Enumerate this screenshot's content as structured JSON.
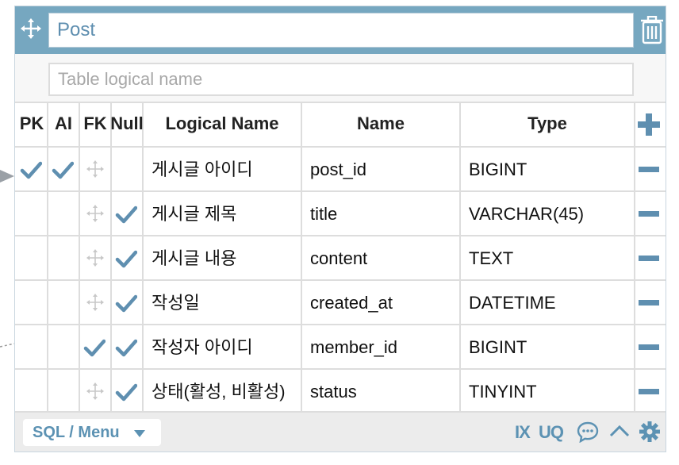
{
  "table": {
    "name": "Post",
    "logical_name": "",
    "logical_name_placeholder": "Table logical name"
  },
  "columns_header": {
    "pk": "PK",
    "ai": "AI",
    "fk": "FK",
    "null": "Null",
    "logical_name": "Logical Name",
    "name": "Name",
    "type": "Type"
  },
  "rows": [
    {
      "pk": true,
      "ai": true,
      "fk": false,
      "null": false,
      "logical_name": "게시글 아이디",
      "name": "post_id",
      "type": "BIGINT"
    },
    {
      "pk": false,
      "ai": false,
      "fk": false,
      "null": true,
      "logical_name": "게시글 제목",
      "name": "title",
      "type": "VARCHAR(45)"
    },
    {
      "pk": false,
      "ai": false,
      "fk": false,
      "null": true,
      "logical_name": "게시글 내용",
      "name": "content",
      "type": "TEXT"
    },
    {
      "pk": false,
      "ai": false,
      "fk": false,
      "null": true,
      "logical_name": "작성일",
      "name": "created_at",
      "type": "DATETIME"
    },
    {
      "pk": false,
      "ai": false,
      "fk": true,
      "null": true,
      "logical_name": "작성자 아이디",
      "name": "member_id",
      "type": "BIGINT"
    },
    {
      "pk": false,
      "ai": false,
      "fk": false,
      "null": true,
      "logical_name": "상태(활성, 비활성)",
      "name": "status",
      "type": "TINYINT"
    }
  ],
  "footer": {
    "sql_menu_label": "SQL / Menu",
    "ix_label": "IX",
    "uq_label": "UQ"
  },
  "colors": {
    "header_bg": "#76a7c0",
    "accent": "#5c92b3",
    "check": "#5f8fb0",
    "footer_bg": "#ececec"
  },
  "icons": {
    "move": "move-arrows-icon",
    "delete": "trash-icon",
    "add_column": "plus-icon",
    "remove_column": "minus-icon",
    "comment": "comment-icon",
    "collapse": "chevron-up-icon",
    "settings": "gear-icon"
  }
}
